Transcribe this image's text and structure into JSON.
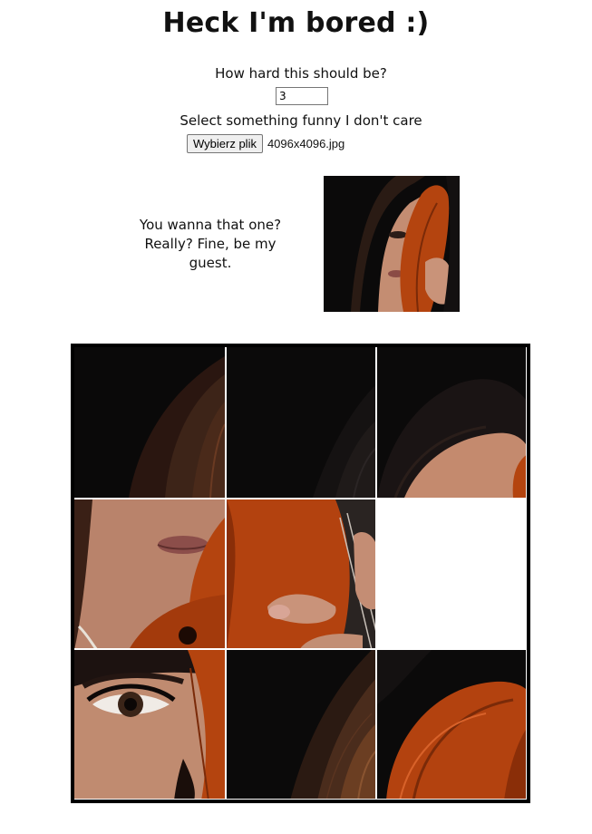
{
  "page": {
    "title": "Heck I'm bored :)"
  },
  "difficulty": {
    "label": "How hard this should be?",
    "value": "3"
  },
  "file_picker": {
    "label": "Select something funny I don't care",
    "button_label": "Wybierz plik",
    "file_name": "4096x4096.jpg"
  },
  "preview": {
    "text": "You wanna that one? Really? Fine, be my guest."
  },
  "puzzle": {
    "grid_size": 3,
    "tiles": [
      {
        "piece": "hair-dark-left",
        "position": 1
      },
      {
        "piece": "dark-hair-curve",
        "position": 2
      },
      {
        "piece": "forehead-violin",
        "position": 3
      },
      {
        "piece": "lips-violin",
        "position": 4
      },
      {
        "piece": "violin-hand",
        "position": 5
      },
      {
        "piece": "empty",
        "position": 6
      },
      {
        "piece": "eye-violin",
        "position": 7
      },
      {
        "piece": "hair-strands",
        "position": 8
      },
      {
        "piece": "violin-body",
        "position": 9
      }
    ],
    "colors": {
      "background": "#0a0909",
      "violin": "#b3420f",
      "skin": "#c99379",
      "border": "#000000"
    }
  }
}
